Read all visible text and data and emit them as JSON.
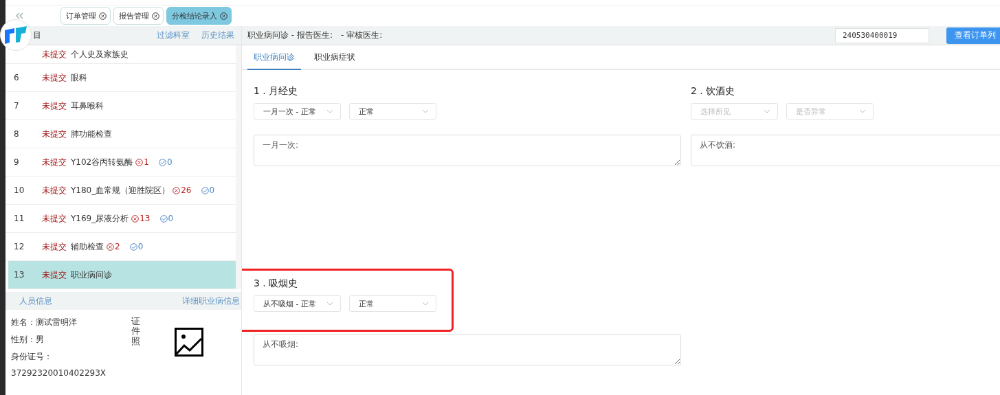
{
  "tabs": [
    {
      "label": "订单管理",
      "selected": false
    },
    {
      "label": "报告管理",
      "selected": false
    },
    {
      "label": "分检结论录入",
      "selected": true
    }
  ],
  "left_panel": {
    "title": "目",
    "links": [
      "过滤科室",
      "历史结果"
    ],
    "items": [
      {
        "status": "未提交",
        "name": "个人史及家族史",
        "selected": false
      },
      {
        "number": "6",
        "status": "未提交",
        "name": "眼科",
        "selected": false
      },
      {
        "number": "7",
        "status": "未提交",
        "name": "耳鼻喉科",
        "selected": false
      },
      {
        "number": "8",
        "status": "未提交",
        "name": "肺功能检查",
        "selected": false
      },
      {
        "number": "9",
        "status": "未提交",
        "name": "Y102谷丙转氨酶",
        "abnormal": "1",
        "normal": "0",
        "selected": false
      },
      {
        "number": "10",
        "status": "未提交",
        "name": "Y180_血常规（迎胜院区）",
        "abnormal": "26",
        "normal": "0",
        "selected": false
      },
      {
        "number": "11",
        "status": "未提交",
        "name": "Y169_尿液分析",
        "abnormal": "13",
        "normal": "0",
        "selected": false
      },
      {
        "number": "12",
        "status": "未提交",
        "name": "辅助检查",
        "abnormal": "2",
        "normal": "0",
        "selected": false
      },
      {
        "number": "13",
        "status": "未提交",
        "name": "职业病问诊",
        "selected": true
      }
    ]
  },
  "person_info": {
    "title": "人员信息",
    "link": "详细职业病信息",
    "lines": [
      "姓名：测试雷明洋",
      "性别：男",
      "身份证号：",
      "37292320010402293X"
    ],
    "photo_label": "证件照"
  },
  "header": {
    "report_doctor": "职业病问诊 - 报告医生:",
    "review_doctor": "- 审核医生:",
    "order_field": "240530400019",
    "button": "查看订单列"
  },
  "sub_tabs": [
    {
      "label": "职业病问诊",
      "selected": true
    },
    {
      "label": "职业病症状",
      "selected": false
    }
  ],
  "sections": [
    {
      "title": "1 . 月经史",
      "selects": [
        {
          "value": "一月一次 - 正常"
        },
        {
          "value": "正常"
        }
      ],
      "note": "一月一次:",
      "highlighted": false
    },
    {
      "title": "2 . 饮酒史",
      "selects": [
        {
          "placeholder": "选择所见"
        },
        {
          "placeholder": "是否异常"
        }
      ],
      "note": "从不饮酒:",
      "highlighted": false
    },
    {
      "title": "3 . 吸烟史",
      "selects": [
        {
          "value": "从不吸烟 - 正常"
        },
        {
          "value": "正常"
        }
      ],
      "note": "从不吸烟:",
      "highlighted": true
    }
  ]
}
